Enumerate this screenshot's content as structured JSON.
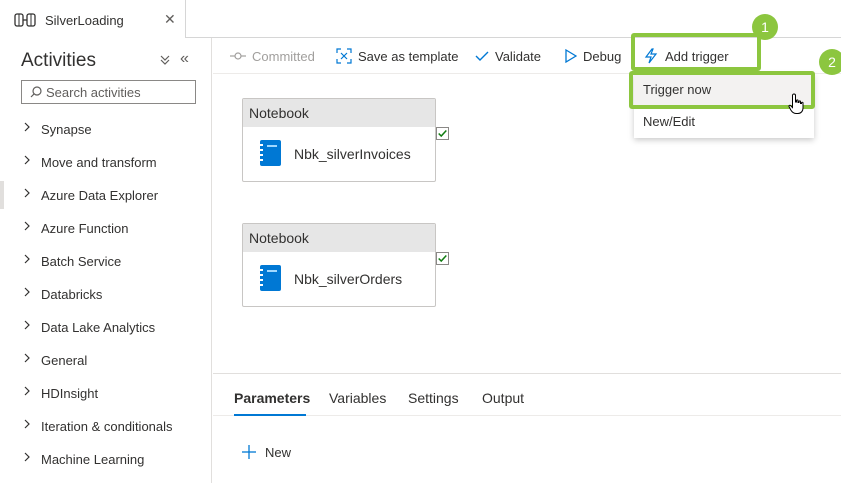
{
  "tab": {
    "title": "SilverLoading",
    "icon": "pipeline-icon",
    "close_icon": "close-icon"
  },
  "activities": {
    "title": "Activities",
    "search_placeholder": "Search activities",
    "items": [
      {
        "label": "Synapse"
      },
      {
        "label": "Move and transform"
      },
      {
        "label": "Azure Data Explorer"
      },
      {
        "label": "Azure Function"
      },
      {
        "label": "Batch Service"
      },
      {
        "label": "Databricks"
      },
      {
        "label": "Data Lake Analytics"
      },
      {
        "label": "General"
      },
      {
        "label": "HDInsight"
      },
      {
        "label": "Iteration & conditionals"
      },
      {
        "label": "Machine Learning"
      }
    ]
  },
  "toolbar": {
    "committed": "Committed",
    "save_template": "Save as template",
    "validate": "Validate",
    "debug": "Debug",
    "add_trigger": "Add trigger"
  },
  "trigger_menu": {
    "items": [
      {
        "label": "Trigger now"
      },
      {
        "label": "New/Edit"
      }
    ]
  },
  "callouts": {
    "one": "1",
    "two": "2"
  },
  "canvas": {
    "nodes": [
      {
        "type": "Notebook",
        "name": "Nbk_silverInvoices"
      },
      {
        "type": "Notebook",
        "name": "Nbk_silverOrders"
      }
    ]
  },
  "bottom_panel": {
    "tabs": [
      {
        "label": "Parameters",
        "active": true
      },
      {
        "label": "Variables"
      },
      {
        "label": "Settings"
      },
      {
        "label": "Output"
      }
    ],
    "new_label": "New"
  },
  "colors": {
    "accent": "#0078d4",
    "highlight": "#8cc63f",
    "check": "#107c10"
  }
}
